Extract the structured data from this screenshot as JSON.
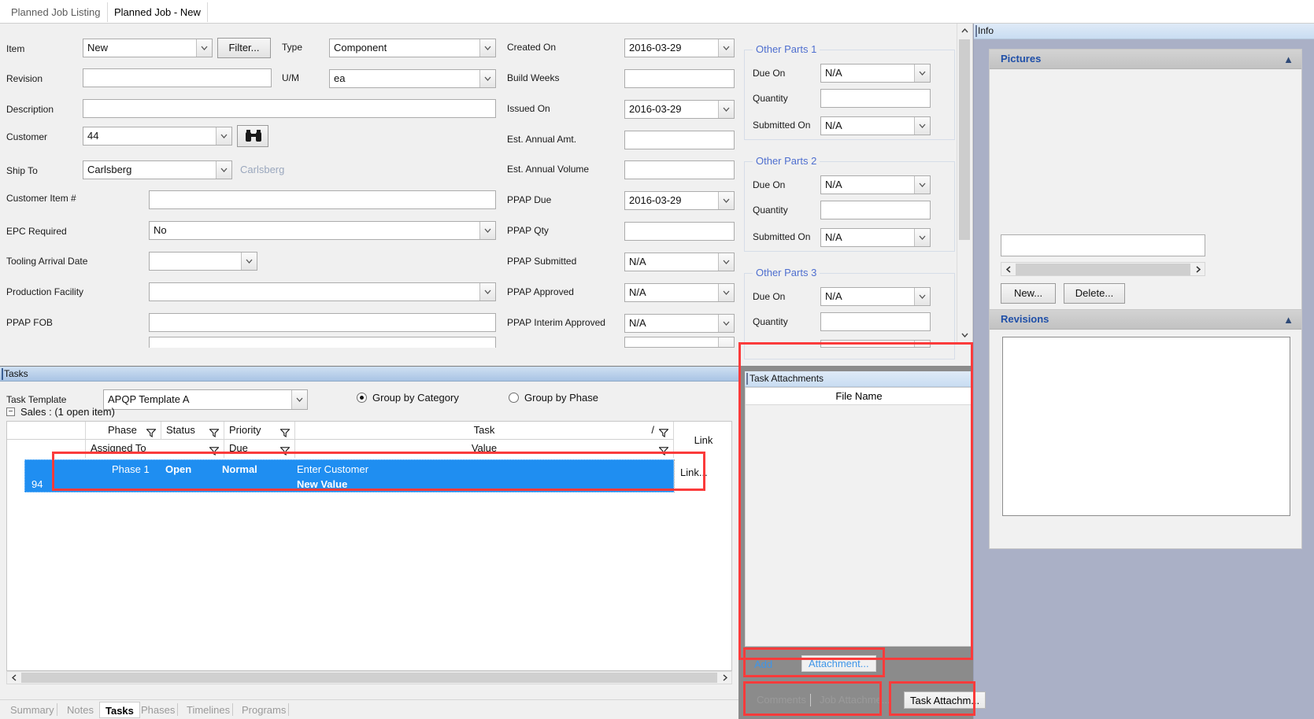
{
  "window": {
    "close_label": "✕"
  },
  "top_tabs": [
    {
      "label": "Planned Job Listing",
      "active": false
    },
    {
      "label": "Planned Job - New",
      "active": true
    }
  ],
  "form": {
    "left_fields": [
      {
        "label": "Item",
        "value": "New",
        "kind": "combo"
      },
      {
        "label": "Revision",
        "value": "",
        "kind": "text"
      },
      {
        "label": "Description",
        "value": "",
        "kind": "text"
      },
      {
        "label": "Customer",
        "value": "44",
        "kind": "combo"
      },
      {
        "label": "Ship To",
        "value": "Carlsberg",
        "kind": "combo"
      },
      {
        "label": "Customer Item #",
        "value": "",
        "kind": "text"
      },
      {
        "label": "EPC Required",
        "value": "No",
        "kind": "combo"
      },
      {
        "label": "Tooling Arrival Date",
        "value": "",
        "kind": "combo"
      },
      {
        "label": "Production Facility",
        "value": "",
        "kind": "combo"
      },
      {
        "label": "PPAP FOB",
        "value": "",
        "kind": "text"
      }
    ],
    "filter_button": "Filter...",
    "ship_to_note": "Carlsberg",
    "search_icon": "binoculars-icon",
    "type_label": "Type",
    "type_value": "Component",
    "um_label": "U/M",
    "um_value": "ea",
    "mid_fields": [
      {
        "label": "Created On",
        "value": "2016-03-29",
        "kind": "combo"
      },
      {
        "label": "Build Weeks",
        "value": "",
        "kind": "text"
      },
      {
        "label": "Issued On",
        "value": "2016-03-29",
        "kind": "combo"
      },
      {
        "label": "Est. Annual Amt.",
        "value": "",
        "kind": "text"
      },
      {
        "label": "Est. Annual Volume",
        "value": "",
        "kind": "text"
      },
      {
        "label": "PPAP Due",
        "value": "2016-03-29",
        "kind": "combo"
      },
      {
        "label": "PPAP Qty",
        "value": "",
        "kind": "text"
      },
      {
        "label": "PPAP Submitted",
        "value": "N/A",
        "kind": "combo"
      },
      {
        "label": "PPAP Approved",
        "value": "N/A",
        "kind": "combo"
      },
      {
        "label": "PPAP Interim Approved",
        "value": "N/A",
        "kind": "combo"
      }
    ],
    "other_parts": [
      {
        "title": "Other Parts 1",
        "rows": [
          {
            "label": "Due On",
            "value": "N/A",
            "kind": "combo"
          },
          {
            "label": "Quantity",
            "value": "",
            "kind": "text"
          },
          {
            "label": "Submitted On",
            "value": "N/A",
            "kind": "combo"
          }
        ]
      },
      {
        "title": "Other Parts 2",
        "rows": [
          {
            "label": "Due On",
            "value": "N/A",
            "kind": "combo"
          },
          {
            "label": "Quantity",
            "value": "",
            "kind": "text"
          },
          {
            "label": "Submitted On",
            "value": "N/A",
            "kind": "combo"
          }
        ]
      },
      {
        "title": "Other Parts 3",
        "rows": [
          {
            "label": "Due On",
            "value": "N/A",
            "kind": "combo"
          },
          {
            "label": "Quantity",
            "value": "",
            "kind": "text"
          }
        ]
      }
    ]
  },
  "info": {
    "header": "Info",
    "pictures": {
      "title": "Pictures",
      "collapse_icon": "chevron-up-icon",
      "caption_value": "",
      "new_button": "New...",
      "delete_button": "Delete...",
      "scroll_left_icon": "chevron-left-icon",
      "scroll_right_icon": "chevron-right-icon"
    },
    "revisions": {
      "title": "Revisions",
      "collapse_icon": "chevron-up-icon"
    }
  },
  "tasks": {
    "header": "Tasks",
    "template_label": "Task Template",
    "template_value": "APQP Template A",
    "group_by_category": "Group by Category",
    "group_by_phase": "Group by Phase",
    "group_by_selected": "category",
    "group_row": "Sales : (1 open item)",
    "columns_row1": [
      "Phase",
      "Status",
      "Priority",
      "Task",
      "/"
    ],
    "columns_row2": [
      "Assigned To",
      "Due",
      "Value"
    ],
    "link_column": "Link",
    "selected_row": {
      "phase": "Phase 1",
      "status": "Open",
      "priority": "Normal",
      "task": "Enter Customer",
      "assigned_to": "94",
      "due": "",
      "value": "New Value",
      "link": "Link..."
    },
    "bottom_tabs": [
      {
        "label": "Summary",
        "active": false
      },
      {
        "label": "Notes",
        "active": false
      },
      {
        "label": "Tasks",
        "active": true
      },
      {
        "label": "Phases",
        "active": false
      },
      {
        "label": "Timelines",
        "active": false
      },
      {
        "label": "Programs",
        "active": false
      }
    ]
  },
  "attachments": {
    "header": "Task Attachments",
    "file_name_column": "File Name",
    "add_link": "Add",
    "attachment_link": "Attachment...",
    "bottom_tabs": [
      {
        "label": "Comments",
        "active": false
      },
      {
        "label": "Job  Attachme...",
        "active": false
      },
      {
        "label": "Task  Attachm...",
        "active": true
      }
    ]
  },
  "colors": {
    "selection_blue": "#1f8ef1",
    "highlight_red": "#fb3b3b",
    "group_title_blue": "#4f6fcf",
    "card_title_blue": "#1f4fa8",
    "link_blue": "#3f95e8"
  }
}
